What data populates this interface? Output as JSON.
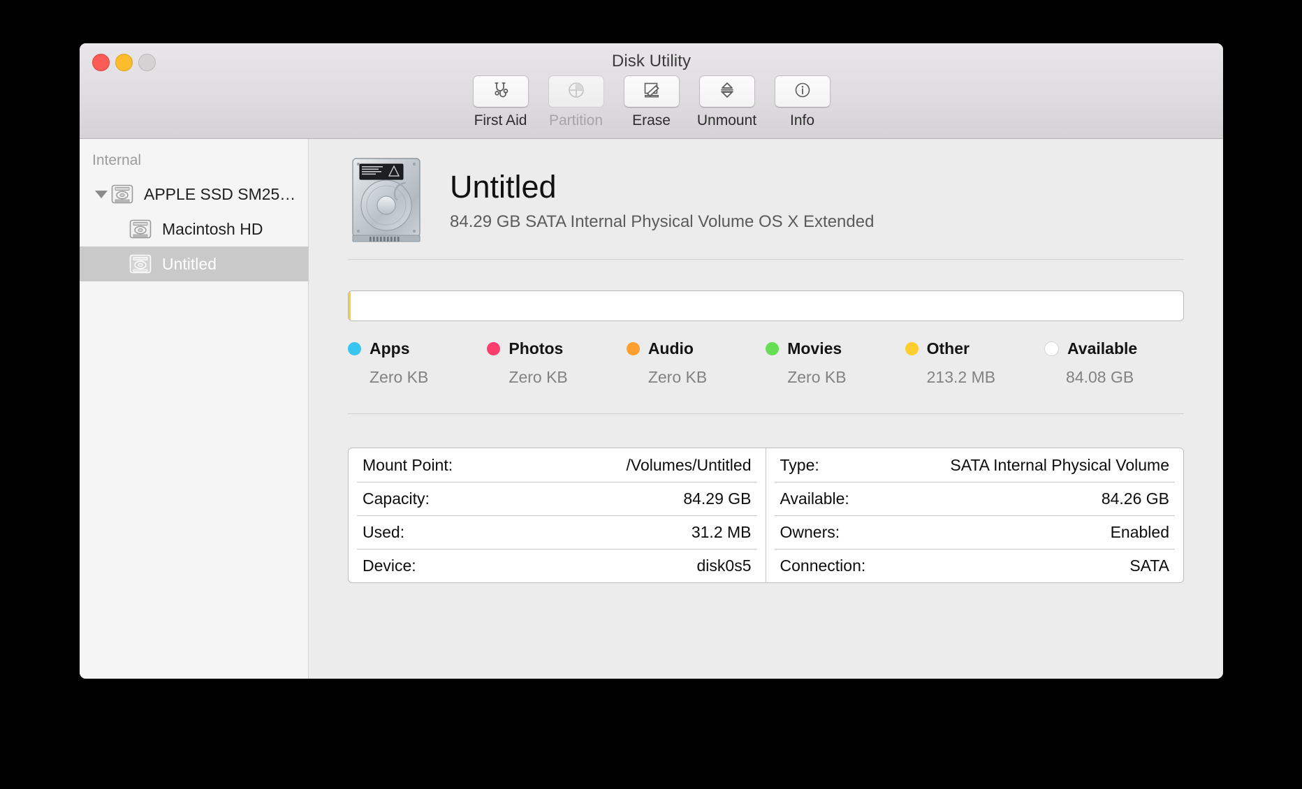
{
  "window": {
    "title": "Disk Utility",
    "controls": [
      {
        "name": "close",
        "color": "#fb5c55"
      },
      {
        "name": "minimize",
        "color": "#fcbc2c"
      },
      {
        "name": "zoom",
        "color": "#d4d2d2"
      }
    ]
  },
  "toolbar": {
    "items": [
      {
        "label": "First Aid",
        "icon": "stethoscope-icon",
        "enabled": true
      },
      {
        "label": "Partition",
        "icon": "pie-chart-icon",
        "enabled": false
      },
      {
        "label": "Erase",
        "icon": "erase-icon",
        "enabled": true
      },
      {
        "label": "Unmount",
        "icon": "unmount-icon",
        "enabled": true
      },
      {
        "label": "Info",
        "icon": "info-circle-icon",
        "enabled": true
      }
    ]
  },
  "sidebar": {
    "section_header": "Internal",
    "items": [
      {
        "label": "APPLE SSD SM25…",
        "level": 0,
        "expanded": true,
        "selected": false,
        "icon": "hard-drive-icon"
      },
      {
        "label": "Macintosh HD",
        "level": 1,
        "expanded": false,
        "selected": false,
        "icon": "hard-drive-icon"
      },
      {
        "label": "Untitled",
        "level": 1,
        "expanded": false,
        "selected": true,
        "icon": "hard-drive-icon"
      }
    ]
  },
  "volume": {
    "name": "Untitled",
    "subtitle": "84.29 GB SATA Internal Physical Volume OS X Extended",
    "icon": "internal-hard-drive-large-icon"
  },
  "chart_data": {
    "type": "bar",
    "title": "Volume capacity usage",
    "orientation": "horizontal-stacked",
    "total_label": "84.29 GB",
    "categories": [
      "Apps",
      "Photos",
      "Audio",
      "Movies",
      "Other",
      "Available"
    ],
    "value_labels": [
      "Zero KB",
      "Zero KB",
      "Zero KB",
      "Zero KB",
      "213.2 MB",
      "84.08 GB"
    ],
    "values_bytes": [
      0,
      0,
      0,
      0,
      213200000,
      84080000000
    ],
    "percentages": [
      0,
      0,
      0,
      0,
      0.25,
      99.75
    ],
    "colors": [
      "#3ac4f0",
      "#fc3d6e",
      "#ff9f2e",
      "#66dd55",
      "#ffce2e",
      "#ffffff"
    ],
    "legend_position": "below",
    "grid": false
  },
  "info": {
    "left": [
      {
        "key": "Mount Point:",
        "value": "/Volumes/Untitled"
      },
      {
        "key": "Capacity:",
        "value": "84.29 GB"
      },
      {
        "key": "Used:",
        "value": "31.2 MB"
      },
      {
        "key": "Device:",
        "value": "disk0s5"
      }
    ],
    "right": [
      {
        "key": "Type:",
        "value": "SATA Internal Physical Volume"
      },
      {
        "key": "Available:",
        "value": "84.26 GB"
      },
      {
        "key": "Owners:",
        "value": "Enabled"
      },
      {
        "key": "Connection:",
        "value": "SATA"
      }
    ]
  }
}
